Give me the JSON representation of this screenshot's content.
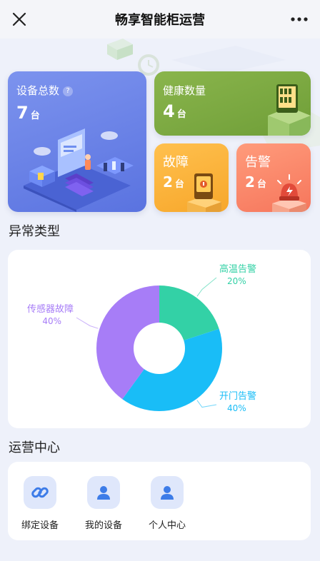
{
  "header": {
    "title": "畅享智能柜运营"
  },
  "stats": {
    "total": {
      "label": "设备总数",
      "value": "7",
      "unit": "台"
    },
    "health": {
      "label": "健康数量",
      "value": "4",
      "unit": "台"
    },
    "fault": {
      "label": "故障",
      "value": "2",
      "unit": "台"
    },
    "alarm": {
      "label": "告警",
      "value": "2",
      "unit": "台"
    }
  },
  "abnormal": {
    "title": "异常类型"
  },
  "chart_data": {
    "type": "pie",
    "title": "",
    "categories": [
      "高温告警",
      "开门告警",
      "传感器故障"
    ],
    "values": [
      20,
      40,
      40
    ],
    "value_labels": [
      "20%",
      "40%",
      "40%"
    ],
    "colors": [
      "#33d1a6",
      "#19bdf7",
      "#a77df7"
    ]
  },
  "ops": {
    "title": "运营中心",
    "items": [
      {
        "label": "绑定设备",
        "icon": "link-icon"
      },
      {
        "label": "我的设备",
        "icon": "user-icon"
      },
      {
        "label": "个人中心",
        "icon": "user-icon"
      }
    ]
  }
}
